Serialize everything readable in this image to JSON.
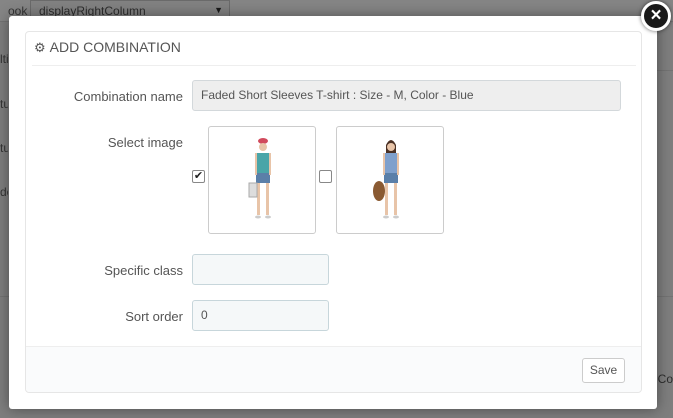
{
  "background": {
    "hook_label_fragment": "ook",
    "select_value": "displayRightColumn",
    "left_fragments": [
      "lti",
      "tu",
      "tu",
      "de"
    ],
    "right_fragment": "Co"
  },
  "modal": {
    "close_label": "×",
    "title": "ADD COMBINATION",
    "form": {
      "combination_name_label": "Combination name",
      "combination_name_value": "Faded Short Sleeves T-shirt : Size - M, Color - Blue",
      "select_image_label": "Select image",
      "images": [
        {
          "checked": true,
          "icon": "product-photo-1"
        },
        {
          "checked": false,
          "icon": "product-photo-2"
        }
      ],
      "specific_class_label": "Specific class",
      "specific_class_value": "",
      "sort_order_label": "Sort order",
      "sort_order_value": "0"
    },
    "footer": {
      "save_label": "Save"
    }
  }
}
